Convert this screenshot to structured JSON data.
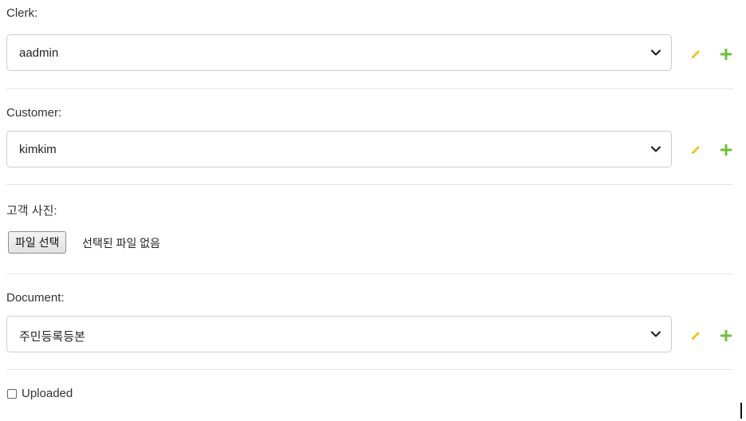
{
  "form": {
    "clerk": {
      "label": "Clerk:",
      "value": "aadmin",
      "edit_icon": "pencil-icon",
      "add_icon": "plus-icon"
    },
    "customer": {
      "label": "Customer:",
      "value": "kimkim",
      "edit_icon": "pencil-icon",
      "add_icon": "plus-icon"
    },
    "photo": {
      "label": "고객 사진:",
      "button_label": "파일 선택",
      "status": "선택된 파일 없음"
    },
    "document": {
      "label": "Document:",
      "value": "주민등록등본",
      "edit_icon": "pencil-icon",
      "add_icon": "plus-icon"
    },
    "uploaded": {
      "label": "Uploaded",
      "checked": false
    }
  },
  "colors": {
    "edit_icon": "#f0c419",
    "add_icon": "#6fbf3a",
    "border": "#cccccc",
    "divider": "#e5e5e5"
  }
}
